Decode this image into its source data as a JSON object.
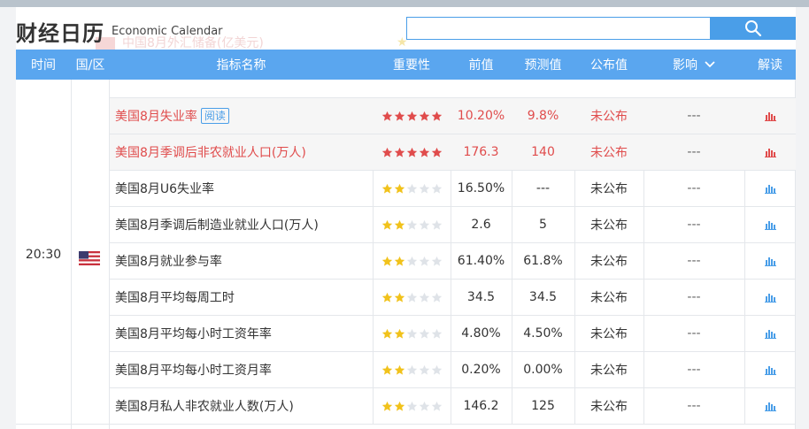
{
  "page": {
    "title": "财经日历",
    "subtitle": "Economic Calendar",
    "ghost_text": "中国8月外汇储备(亿美元)"
  },
  "search": {
    "placeholder": "",
    "value": ""
  },
  "table": {
    "headers": {
      "time": "时间",
      "region": "国/区",
      "indicator": "指标名称",
      "importance": "重要性",
      "previous": "前值",
      "forecast": "预测值",
      "actual": "公布值",
      "impact": "影响",
      "interpretation": "解读"
    },
    "group": {
      "time": "20:30",
      "country": "US"
    },
    "rows": [
      {
        "name": "美国8月失业率",
        "tag": "阅读",
        "stars": 5,
        "previous": "10.20%",
        "forecast": "9.8%",
        "actual": "未公布",
        "impact": "---",
        "highlight": true
      },
      {
        "name": "美国8月季调后非农就业人口(万人)",
        "tag": "",
        "stars": 5,
        "previous": "176.3",
        "forecast": "140",
        "actual": "未公布",
        "impact": "---",
        "highlight": true
      },
      {
        "name": "美国8月U6失业率",
        "tag": "",
        "stars": 2,
        "previous": "16.50%",
        "forecast": "---",
        "actual": "未公布",
        "impact": "---",
        "highlight": false
      },
      {
        "name": "美国8月季调后制造业就业人口(万人)",
        "tag": "",
        "stars": 2,
        "previous": "2.6",
        "forecast": "5",
        "actual": "未公布",
        "impact": "---",
        "highlight": false
      },
      {
        "name": "美国8月就业参与率",
        "tag": "",
        "stars": 2,
        "previous": "61.40%",
        "forecast": "61.8%",
        "actual": "未公布",
        "impact": "---",
        "highlight": false
      },
      {
        "name": "美国8月平均每周工时",
        "tag": "",
        "stars": 2,
        "previous": "34.5",
        "forecast": "34.5",
        "actual": "未公布",
        "impact": "---",
        "highlight": false
      },
      {
        "name": "美国8月平均每小时工资年率",
        "tag": "",
        "stars": 2,
        "previous": "4.80%",
        "forecast": "4.50%",
        "actual": "未公布",
        "impact": "---",
        "highlight": false
      },
      {
        "name": "美国8月平均每小时工资月率",
        "tag": "",
        "stars": 2,
        "previous": "0.20%",
        "forecast": "0.00%",
        "actual": "未公布",
        "impact": "---",
        "highlight": false
      },
      {
        "name": "美国8月私人非农就业人数(万人)",
        "tag": "",
        "stars": 2,
        "previous": "146.2",
        "forecast": "125",
        "actual": "未公布",
        "impact": "---",
        "highlight": false
      }
    ]
  },
  "colors": {
    "accent": "#5aa6ef",
    "highlight_text": "#e04c4c",
    "star_red": "#e04c4c",
    "star_gold": "#f1c21b",
    "star_empty": "#dfe3e8",
    "chart_icon_red": "#e04c4c",
    "chart_icon_blue": "#4a9ee8"
  },
  "icons": {
    "search": "search-icon",
    "impact_dropdown": "chevron-down-icon",
    "interpretation": "bar-chart-icon",
    "flag": "us-flag-icon"
  }
}
